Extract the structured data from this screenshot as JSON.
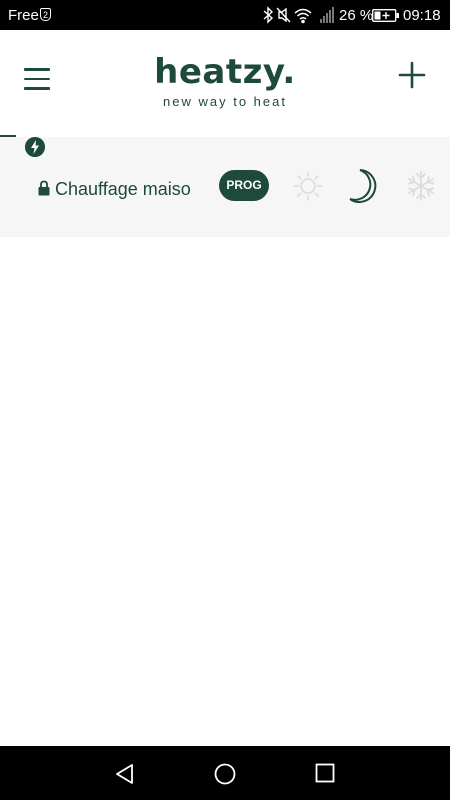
{
  "status_bar": {
    "carrier": "Free",
    "sim_slot": "2",
    "battery_percent": "26 %",
    "time": "09:18"
  },
  "header": {
    "brand": "heatzy.",
    "tagline": "new way to heat",
    "menu_icon": "hamburger-menu-icon",
    "add_icon": "plus-icon"
  },
  "device": {
    "name": "Chauffage maiso",
    "locked": true,
    "status_icon": "lightning-bolt-icon",
    "active_mode_label": "PROG",
    "modes": [
      {
        "name": "comfort",
        "icon": "sun-icon",
        "active": false
      },
      {
        "name": "eco",
        "icon": "moon-icon",
        "active": true
      },
      {
        "name": "frost-protection",
        "icon": "snowflake-icon",
        "active": false
      }
    ]
  },
  "colors": {
    "accent": "#1e4a3a",
    "card_background": "#f6f6f6",
    "inactive_icon": "#dcdcdc"
  },
  "nav_bar": {
    "back_icon": "back-triangle-icon",
    "home_icon": "home-circle-icon",
    "recents_icon": "recents-square-icon"
  }
}
